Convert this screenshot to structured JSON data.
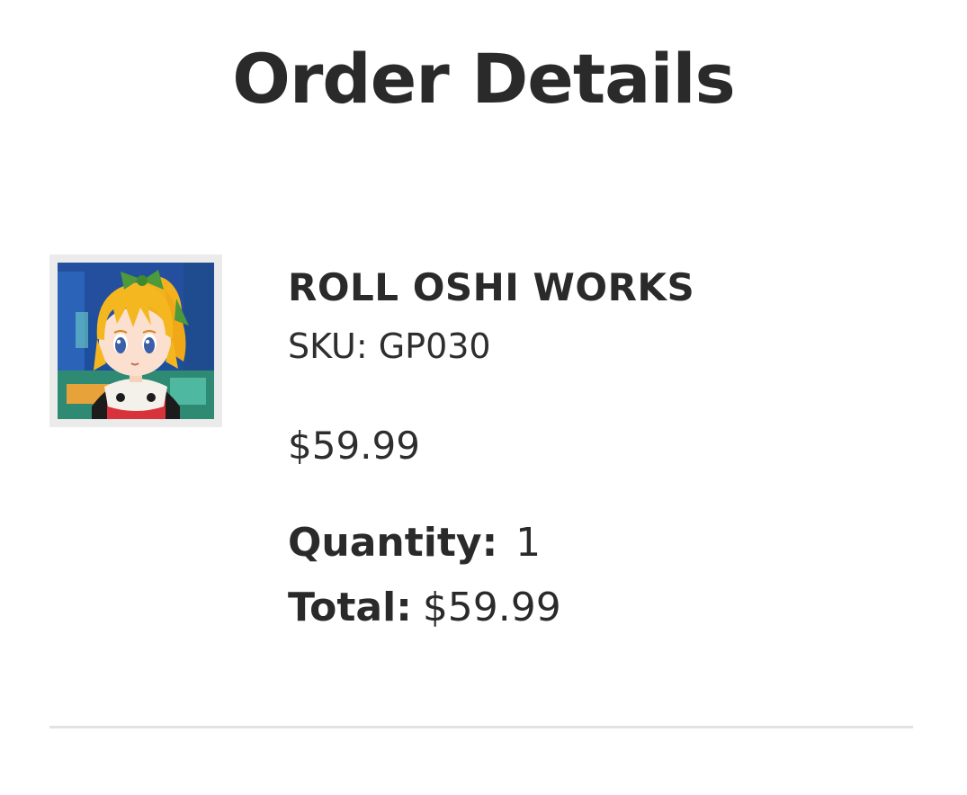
{
  "page": {
    "title": "Order Details"
  },
  "order_item": {
    "image_alt": "ROLL OSHI WORKS product image",
    "name": "ROLL OSHI WORKS",
    "sku": "SKU: GP030",
    "price": "$59.99",
    "quantity_label": "Quantity:",
    "quantity_value": "1",
    "total_label": "Total:",
    "total_value": "$59.99"
  },
  "colors": {
    "text": "#2a2a2a",
    "divider": "#e2e2e2",
    "thumb_border": "#ebebeb"
  }
}
